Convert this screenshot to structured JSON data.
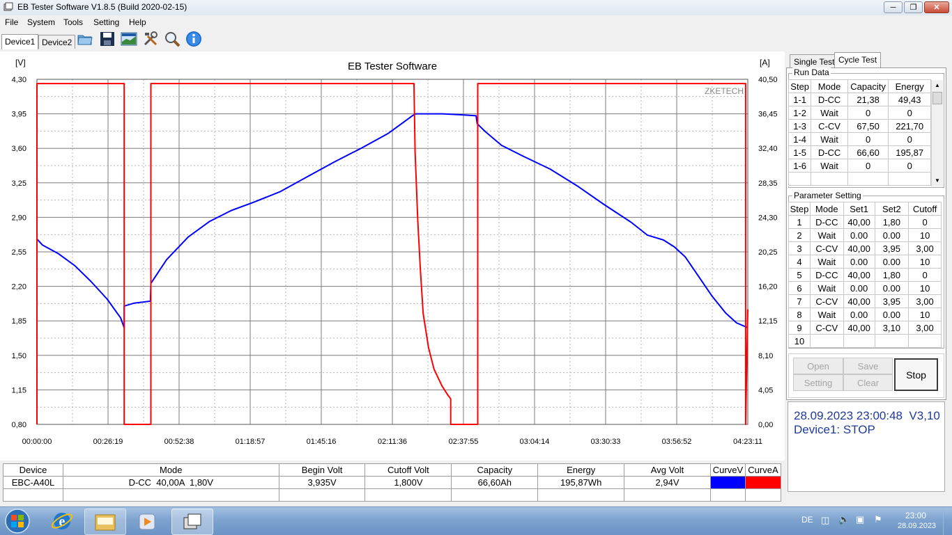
{
  "window": {
    "title": "EB Tester Software V1.8.5 (Build 2020-02-15)"
  },
  "menu": [
    "File",
    "System",
    "Tools",
    "Setting",
    "Help"
  ],
  "toolbar": {
    "device_tabs": [
      "Device1",
      "Device2"
    ]
  },
  "chart_data": {
    "type": "line",
    "title": "EB Tester Software",
    "watermark": "ZKETECH",
    "y_left_unit": "[V]",
    "y_right_unit": "[A]",
    "y_left_ticks": [
      "4,30",
      "3,95",
      "3,60",
      "3,25",
      "2,90",
      "2,55",
      "2,20",
      "1,85",
      "1,50",
      "1,15",
      "0,80"
    ],
    "y_right_ticks": [
      "40,50",
      "36,45",
      "32,40",
      "28,35",
      "24,30",
      "20,25",
      "16,20",
      "12,15",
      "8,10",
      "4,05",
      "0,00"
    ],
    "x_ticks": [
      "00:00:00",
      "00:26:19",
      "00:52:38",
      "01:18:57",
      "01:45:16",
      "02:11:36",
      "02:37:55",
      "03:04:14",
      "03:30:33",
      "03:56:52",
      "04:23:11"
    ],
    "ylim_left": [
      0.8,
      4.3
    ],
    "ylim_right": [
      0,
      40.5
    ],
    "xlim": [
      0,
      263.2
    ],
    "grid": true,
    "series": [
      {
        "unit": "V",
        "color": "#0000ff",
        "x": [
          0,
          2,
          8,
          14,
          20,
          26,
          31,
          32.3,
          32.3,
          36,
          42,
          42.2,
          48,
          56,
          64,
          72,
          80,
          90,
          100,
          110,
          120,
          130,
          139,
          140.2,
          150,
          157,
          162.6,
          163,
          166,
          172,
          180,
          190,
          200,
          210,
          220,
          226,
          232,
          236,
          240,
          245,
          250,
          255,
          259,
          263.2
        ],
        "y": [
          2.68,
          2.62,
          2.53,
          2.41,
          2.25,
          2.07,
          1.88,
          1.78,
          2.0,
          2.03,
          2.05,
          2.23,
          2.47,
          2.7,
          2.86,
          2.97,
          3.05,
          3.16,
          3.31,
          3.46,
          3.6,
          3.75,
          3.93,
          3.95,
          3.95,
          3.94,
          3.93,
          3.85,
          3.77,
          3.63,
          3.52,
          3.39,
          3.22,
          3.03,
          2.85,
          2.72,
          2.67,
          2.6,
          2.5,
          2.3,
          2.1,
          1.93,
          1.83,
          1.78
        ]
      },
      {
        "unit": "A",
        "color": "#ff0000",
        "x": [
          0,
          0,
          32.3,
          32.3,
          42.2,
          42.2,
          139.6,
          140,
          141,
          142,
          143,
          145,
          147,
          150,
          152,
          153.2,
          153.2,
          163.2,
          163.2,
          262.4,
          262.4,
          263.2
        ],
        "y": [
          0,
          40,
          40,
          0,
          0,
          40,
          40,
          32,
          24,
          18,
          13,
          9,
          6.5,
          4.5,
          3.5,
          3.0,
          0,
          0,
          40,
          40,
          0,
          13.5
        ]
      }
    ]
  },
  "info_table": {
    "headers": [
      "Device",
      "Mode",
      "Begin Volt",
      "Cutoff Volt",
      "Capacity",
      "Energy",
      "Avg Volt",
      "CurveV",
      "CurveA"
    ],
    "row": [
      "EBC-A40L",
      "D-CC  40,00A  1,80V",
      "3,935V",
      "1,800V",
      "66,60Ah",
      "195,87Wh",
      "2,94V"
    ],
    "curve_colors": [
      "#0000ff",
      "#ff0000"
    ]
  },
  "right_panel": {
    "tabs": [
      "Single Test",
      "Cycle Test"
    ],
    "run_data": {
      "label": "Run Data",
      "headers": [
        "Step",
        "Mode",
        "Capacity",
        "Energy"
      ],
      "rows": [
        [
          "1-1",
          "D-CC",
          "21,38",
          "49,43"
        ],
        [
          "1-2",
          "Wait",
          "0",
          "0"
        ],
        [
          "1-3",
          "C-CV",
          "67,50",
          "221,70"
        ],
        [
          "1-4",
          "Wait",
          "0",
          "0"
        ],
        [
          "1-5",
          "D-CC",
          "66,60",
          "195,87"
        ],
        [
          "1-6",
          "Wait",
          "0",
          "0"
        ]
      ]
    },
    "params": {
      "label": "Parameter Setting",
      "headers": [
        "Step",
        "Mode",
        "Set1",
        "Set2",
        "Cutoff"
      ],
      "rows": [
        [
          "1",
          "D-CC",
          "40,00",
          "1,80",
          "0"
        ],
        [
          "2",
          "Wait",
          "0.00",
          "0.00",
          "10"
        ],
        [
          "3",
          "C-CV",
          "40,00",
          "3,95",
          "3,00"
        ],
        [
          "4",
          "Wait",
          "0.00",
          "0.00",
          "10"
        ],
        [
          "5",
          "D-CC",
          "40,00",
          "1,80",
          "0"
        ],
        [
          "6",
          "Wait",
          "0.00",
          "0.00",
          "10"
        ],
        [
          "7",
          "C-CV",
          "40,00",
          "3,95",
          "3,00"
        ],
        [
          "8",
          "Wait",
          "0.00",
          "0.00",
          "10"
        ],
        [
          "9",
          "C-CV",
          "40,00",
          "3,10",
          "3,00"
        ],
        [
          "10",
          "",
          "",
          "",
          ""
        ]
      ]
    },
    "buttons": {
      "open": "Open",
      "save": "Save",
      "setting": "Setting",
      "clear": "Clear",
      "stop": "Stop"
    },
    "status": {
      "datetime": "28.09.2023 23:00:48  V3,10",
      "device": "Device1: STOP",
      "color": "#1f3a9c"
    }
  },
  "taskbar": {
    "lang": "DE",
    "time": "23:00",
    "date": "28.09.2023"
  }
}
